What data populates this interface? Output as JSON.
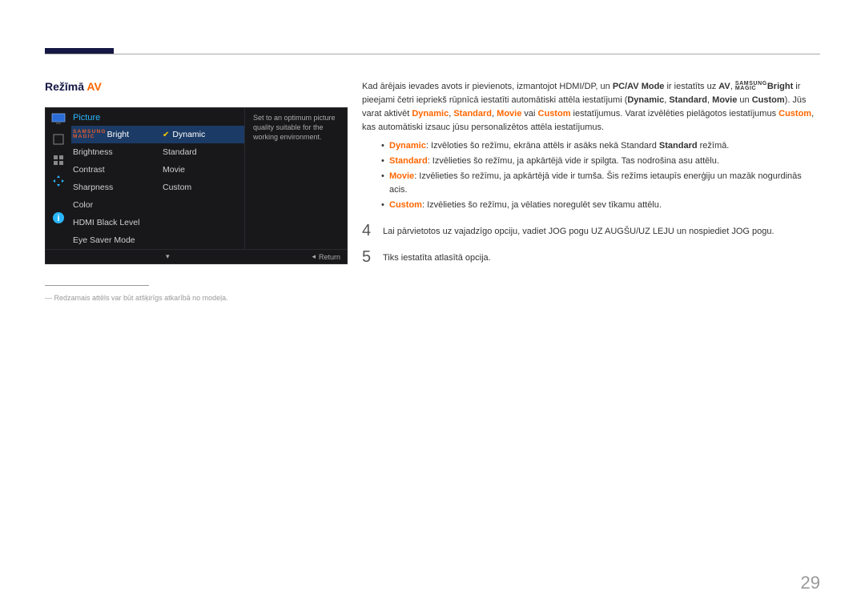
{
  "heading": {
    "prefix": "Režīmā ",
    "accent": "AV"
  },
  "osd": {
    "title": "Picture",
    "magic": {
      "r1": "SAMSUNG",
      "r2": "MAGIC"
    },
    "brightLabel": "Bright",
    "menu": {
      "i1": "Brightness",
      "i2": "Contrast",
      "i3": "Sharpness",
      "i4": "Color",
      "i5": "HDMI Black Level",
      "i6": "Eye Saver Mode"
    },
    "sub": {
      "s1": "Dynamic",
      "s2": "Standard",
      "s3": "Movie",
      "s4": "Custom"
    },
    "desc": "Set to an optimum picture quality suitable for the working environment.",
    "footer": {
      "chev": "▾",
      "backTri": "◂",
      "return": "Return"
    }
  },
  "footnoteDash": "―",
  "footnote": "Redzamais attēls var būt atšķirīgs atkarībā no modeļa.",
  "body": {
    "p1a": "Kad ārējais ievades avots ir pievienots, izmantojot HDMI/DP, un ",
    "p1pcav": "PC/AV Mode",
    "p1b": " ir iestatīts uz ",
    "p1av": "AV",
    "p1c": ", ",
    "p1bright": "Bright",
    "p1d": " ir pieejami četri iepriekš rūpnīcā iestatīti automātiski attēla iestatījumi (",
    "kDynamic": "Dynamic",
    "kStandard": "Standard",
    "kMovie": "Movie",
    "kCustom": "Custom",
    "p1un": " un ",
    "p1e": "). Jūs varat aktivēt ",
    "p1f": " vai ",
    "p1g": " iestatījumus. Varat izvēlēties pielāgotos iestatījumus ",
    "p1h": ", kas automātiski izsauc jūsu personalizētos attēla iestatījumus.",
    "li1a": ": Izvēloties šo režīmu, ekrāna attēls ir asāks nekā Standard ",
    "li1b": " režīmā.",
    "li2": ": Izvēlieties šo režīmu, ja apkārtējā vide ir spilgta. Tas nodrošina asu attēlu.",
    "li3": ": Izvēlieties šo režīmu, ja apkārtējā vide ir tumša. Šis režīms ietaupīs enerģiju un mazāk nogurdinās acis.",
    "li4": ": Izvēlieties šo režīmu, ja vēlaties noregulēt sev tīkamu attēlu.",
    "step4n": "4",
    "step4": "Lai pārvietotos uz vajadzīgo opciju, vadiet JOG pogu UZ AUGŠU/UZ LEJU un nospiediet JOG pogu.",
    "step5n": "5",
    "step5": "Tiks iestatīta atlasītā opcija.",
    "comma": ", "
  },
  "pageNum": "29"
}
